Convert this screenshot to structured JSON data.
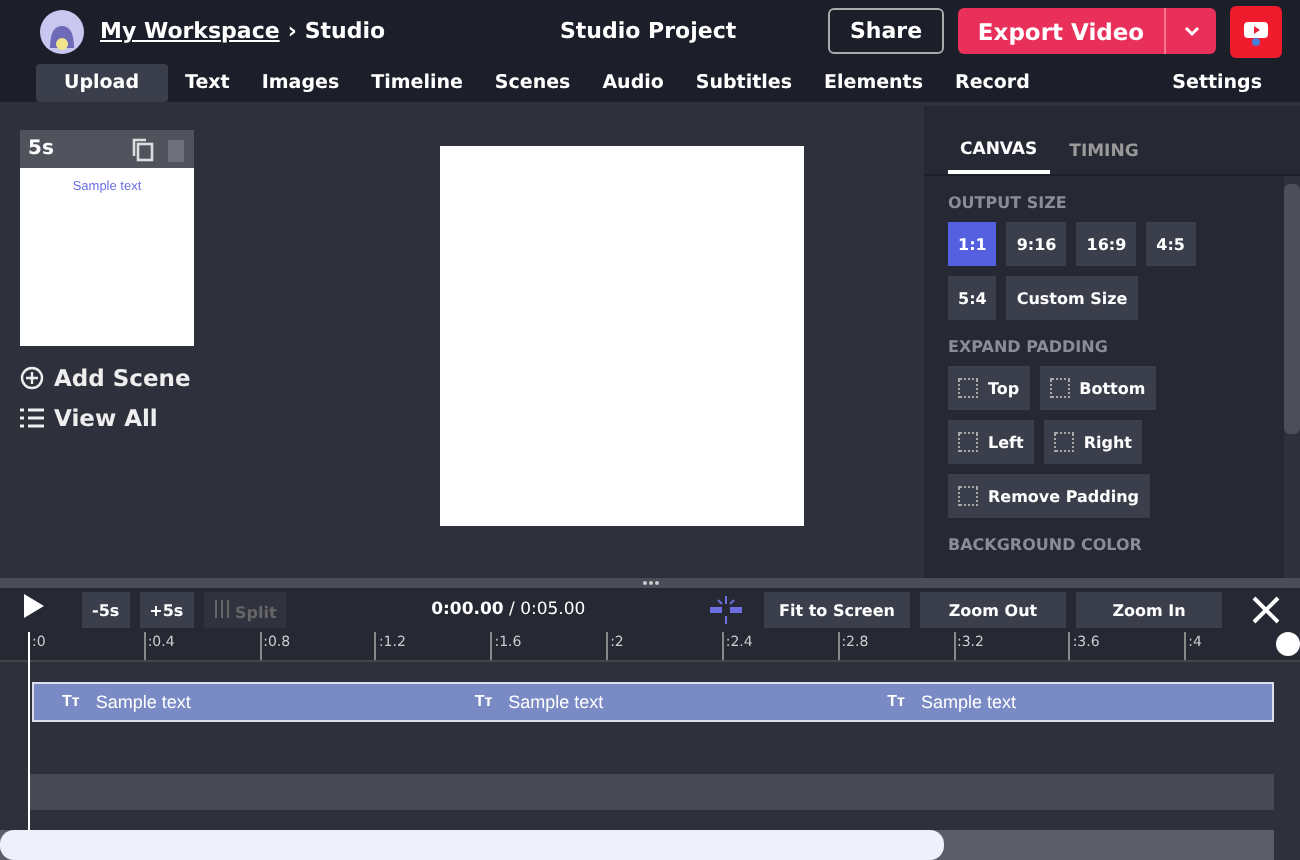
{
  "header": {
    "breadcrumb_link": "My Workspace",
    "breadcrumb_separator": "›",
    "breadcrumb_current": "Studio",
    "project_title": "Studio Project",
    "share": "Share",
    "export": "Export Video"
  },
  "nav": [
    {
      "label": "Upload",
      "selected": true
    },
    {
      "label": "Text",
      "selected": false
    },
    {
      "label": "Images",
      "selected": false
    },
    {
      "label": "Timeline",
      "selected": false
    },
    {
      "label": "Scenes",
      "selected": false
    },
    {
      "label": "Audio",
      "selected": false
    },
    {
      "label": "Subtitles",
      "selected": false
    },
    {
      "label": "Elements",
      "selected": false
    },
    {
      "label": "Record",
      "selected": false
    }
  ],
  "settings": "Settings",
  "scenes": [
    {
      "duration": "5s",
      "text": "Sample text"
    }
  ],
  "scene_actions": [
    "Add Scene",
    "View All"
  ],
  "panel": {
    "tabs": [
      {
        "label": "CANVAS",
        "selected": true
      },
      {
        "label": "TIMING",
        "selected": false
      }
    ],
    "output_size_label": "OUTPUT SIZE",
    "sizes": [
      {
        "label": "1:1",
        "selected": true
      },
      {
        "label": "9:16",
        "selected": false
      },
      {
        "label": "16:9",
        "selected": false
      },
      {
        "label": "4:5",
        "selected": false
      },
      {
        "label": "5:4",
        "selected": false
      },
      {
        "label": "Custom Size",
        "selected": false
      }
    ],
    "padding_label": "EXPAND PADDING",
    "padding": [
      {
        "label": "Top",
        "checked": false
      },
      {
        "label": "Bottom",
        "checked": false
      },
      {
        "label": "Left",
        "checked": false
      },
      {
        "label": "Right",
        "checked": false
      },
      {
        "label": "Remove Padding",
        "checked": false
      }
    ],
    "next_label": "BACKGROUND COLOR"
  },
  "timeline": {
    "back": "-5s",
    "forward": "+5s",
    "split": {
      "label": "Split",
      "disabled": true
    },
    "time_current": "0:00.00",
    "time_total": "/ 0:05.00",
    "fit": "Fit to Screen",
    "zoom_out": "Zoom Out",
    "zoom_in": "Zoom In",
    "ticks": [
      ":0",
      ":0.4",
      ":0.8",
      ":1.2",
      ":1.6",
      ":2",
      ":2.4",
      ":2.8",
      ":3.2",
      ":3.6",
      ":4"
    ],
    "clips": [
      {
        "icon": "Tт",
        "label": "Sample text"
      },
      {
        "icon": "Tт",
        "label": "Sample text"
      },
      {
        "icon": "Tт",
        "label": "Sample text"
      }
    ]
  }
}
